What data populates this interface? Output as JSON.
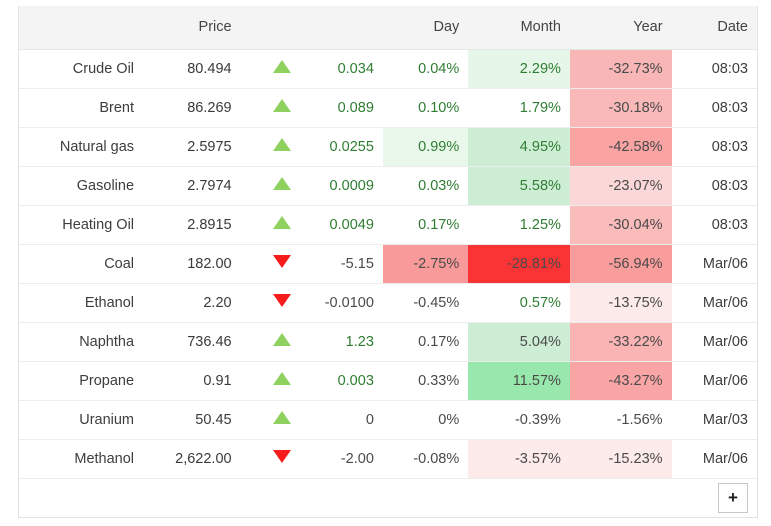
{
  "table": {
    "columns": [
      {
        "key": "name",
        "label": ""
      },
      {
        "key": "price",
        "label": "Price"
      },
      {
        "key": "arrow",
        "label": ""
      },
      {
        "key": "change",
        "label": ""
      },
      {
        "key": "day",
        "label": "Day"
      },
      {
        "key": "month",
        "label": "Month"
      },
      {
        "key": "year",
        "label": "Year"
      },
      {
        "key": "date",
        "label": "Date"
      }
    ],
    "rows": [
      {
        "name": "Crude Oil",
        "price": "80.494",
        "direction": "up",
        "direction_icon": "triangle-up-icon",
        "change": "0.034",
        "change_sign": "positive",
        "day": "0.04%",
        "day_sign": "positive",
        "day_bg": "",
        "month": "2.29%",
        "month_sign": "positive",
        "month_bg": "#e6f6e8",
        "year": "-32.73%",
        "year_sign": "negative",
        "year_bg": "#f9b6b6",
        "date": "08:03"
      },
      {
        "name": "Brent",
        "price": "86.269",
        "direction": "up",
        "direction_icon": "triangle-up-icon",
        "change": "0.089",
        "change_sign": "positive",
        "day": "0.10%",
        "day_sign": "positive",
        "day_bg": "",
        "month": "1.79%",
        "month_sign": "positive",
        "month_bg": "",
        "year": "-30.18%",
        "year_sign": "negative",
        "year_bg": "#fab9b9",
        "date": "08:03"
      },
      {
        "name": "Natural gas",
        "price": "2.5975",
        "direction": "up",
        "direction_icon": "triangle-up-icon",
        "change": "0.0255",
        "change_sign": "positive",
        "day": "0.99%",
        "day_sign": "positive",
        "day_bg": "#eaf8ec",
        "month": "4.95%",
        "month_sign": "positive",
        "month_bg": "#cdeed4",
        "year": "-42.58%",
        "year_sign": "negative",
        "year_bg": "#f9a3a3",
        "date": "08:03"
      },
      {
        "name": "Gasoline",
        "price": "2.7974",
        "direction": "up",
        "direction_icon": "triangle-up-icon",
        "change": "0.0009",
        "change_sign": "positive",
        "day": "0.03%",
        "day_sign": "positive",
        "day_bg": "",
        "month": "5.58%",
        "month_sign": "positive",
        "month_bg": "#cdeed4",
        "year": "-23.07%",
        "year_sign": "negative",
        "year_bg": "#fcd7d7",
        "date": "08:03"
      },
      {
        "name": "Heating Oil",
        "price": "2.8915",
        "direction": "up",
        "direction_icon": "triangle-up-icon",
        "change": "0.0049",
        "change_sign": "positive",
        "day": "0.17%",
        "day_sign": "positive",
        "day_bg": "",
        "month": "1.25%",
        "month_sign": "positive",
        "month_bg": "",
        "year": "-30.04%",
        "year_sign": "negative",
        "year_bg": "#fabbbb",
        "date": "08:03"
      },
      {
        "name": "Coal",
        "price": "182.00",
        "direction": "down",
        "direction_icon": "triangle-down-icon",
        "change": "-5.15",
        "change_sign": "negative",
        "day": "-2.75%",
        "day_sign": "negative",
        "day_bg": "#f99a9a",
        "month": "-28.81%",
        "month_sign": "negative",
        "month_bg": "#fa3434",
        "year": "-56.94%",
        "year_sign": "negative",
        "year_bg": "#f99c9c",
        "date": "Mar/06"
      },
      {
        "name": "Ethanol",
        "price": "2.20",
        "direction": "down",
        "direction_icon": "triangle-down-icon",
        "change": "-0.0100",
        "change_sign": "negative",
        "day": "-0.45%",
        "day_sign": "negative",
        "day_bg": "",
        "month": "0.57%",
        "month_sign": "positive",
        "month_bg": "",
        "year": "-13.75%",
        "year_sign": "negative",
        "year_bg": "#fdeaea",
        "date": "Mar/06"
      },
      {
        "name": "Naphtha",
        "price": "736.46",
        "direction": "up",
        "direction_icon": "triangle-up-icon",
        "change": "1.23",
        "change_sign": "positive",
        "day": "0.17%",
        "day_sign": "negative",
        "day_bg": "",
        "month": "5.04%",
        "month_sign": "negative",
        "month_bg": "#cdeed4",
        "year": "-33.22%",
        "year_sign": "negative",
        "year_bg": "#fab4b4",
        "date": "Mar/06"
      },
      {
        "name": "Propane",
        "price": "0.91",
        "direction": "up",
        "direction_icon": "triangle-up-icon",
        "change": "0.003",
        "change_sign": "positive",
        "day": "0.33%",
        "day_sign": "negative",
        "day_bg": "",
        "month": "11.57%",
        "month_sign": "negative",
        "month_bg": "#98e8ad",
        "year": "-43.27%",
        "year_sign": "negative",
        "year_bg": "#f9a5a5",
        "date": "Mar/06"
      },
      {
        "name": "Uranium",
        "price": "50.45",
        "direction": "up",
        "direction_icon": "triangle-up-icon",
        "change": "0",
        "change_sign": "neutral",
        "day": "0%",
        "day_sign": "neutral",
        "day_bg": "",
        "month": "-0.39%",
        "month_sign": "negative",
        "month_bg": "",
        "year": "-1.56%",
        "year_sign": "negative",
        "year_bg": "",
        "date": "Mar/03"
      },
      {
        "name": "Methanol",
        "price": "2,622.00",
        "direction": "down",
        "direction_icon": "triangle-down-icon",
        "change": "-2.00",
        "change_sign": "negative",
        "day": "-0.08%",
        "day_sign": "negative",
        "day_bg": "",
        "month": "-3.57%",
        "month_sign": "negative",
        "month_bg": "#fdeaea",
        "year": "-15.23%",
        "year_sign": "negative",
        "year_bg": "#fdeaea",
        "date": "Mar/06"
      }
    ],
    "add_button": {
      "label": "+",
      "icon": "plus-icon"
    }
  },
  "colors": {
    "positive_text": "#2f7d32",
    "negative_text": "#4a4a4a",
    "arrow_up": "#7ac943",
    "arrow_down": "#f61c1c",
    "header_bg": "#f4f4f4",
    "border": "#ececec"
  }
}
